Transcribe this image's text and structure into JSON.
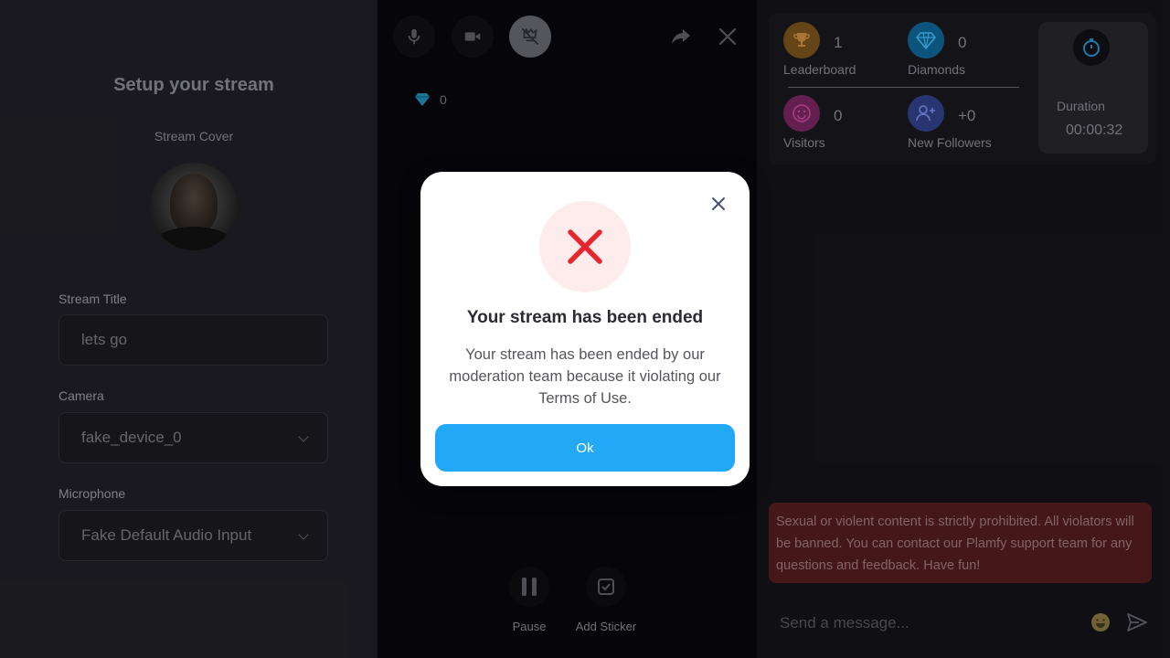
{
  "setup": {
    "title": "Setup your stream",
    "cover_label": "Stream Cover",
    "title_label": "Stream Title",
    "title_value": "lets go",
    "camera_label": "Camera",
    "camera_value": "fake_device_0",
    "microphone_label": "Microphone",
    "microphone_value": "Fake Default Audio Input"
  },
  "player": {
    "diamond_count": "0",
    "pause_label": "Pause",
    "sticker_label": "Add Sticker"
  },
  "stats": {
    "leaderboard_value": "1",
    "leaderboard_label": "Leaderboard",
    "diamonds_value": "0",
    "diamonds_label": "Diamonds",
    "visitors_value": "0",
    "visitors_label": "Visitors",
    "followers_value": "+0",
    "followers_label": "New Followers",
    "duration_label": "Duration",
    "duration_value": "00:00:32"
  },
  "chat": {
    "notice": "Sexual or violent content is strictly prohibited. All violators will be banned. You can contact our Plamfy support team for any questions and feedback. Have fun!",
    "placeholder": "Send a message..."
  },
  "modal": {
    "title": "Your stream has been ended",
    "body": "Your stream has been ended by our moderation team because it violating our Terms of Use.",
    "ok_label": "Ok"
  },
  "colors": {
    "accent": "#21a8f7",
    "error": "#e5262e",
    "error_bg": "#fdeceb"
  },
  "icons": [
    "microphone-icon",
    "camera-icon",
    "effects-off-icon",
    "share-icon",
    "close-icon",
    "diamond-icon",
    "pause-icon",
    "sticker-icon",
    "trophy-icon",
    "gem-icon",
    "smile-icon",
    "add-user-icon",
    "timer-icon",
    "emoji-icon",
    "send-icon"
  ]
}
